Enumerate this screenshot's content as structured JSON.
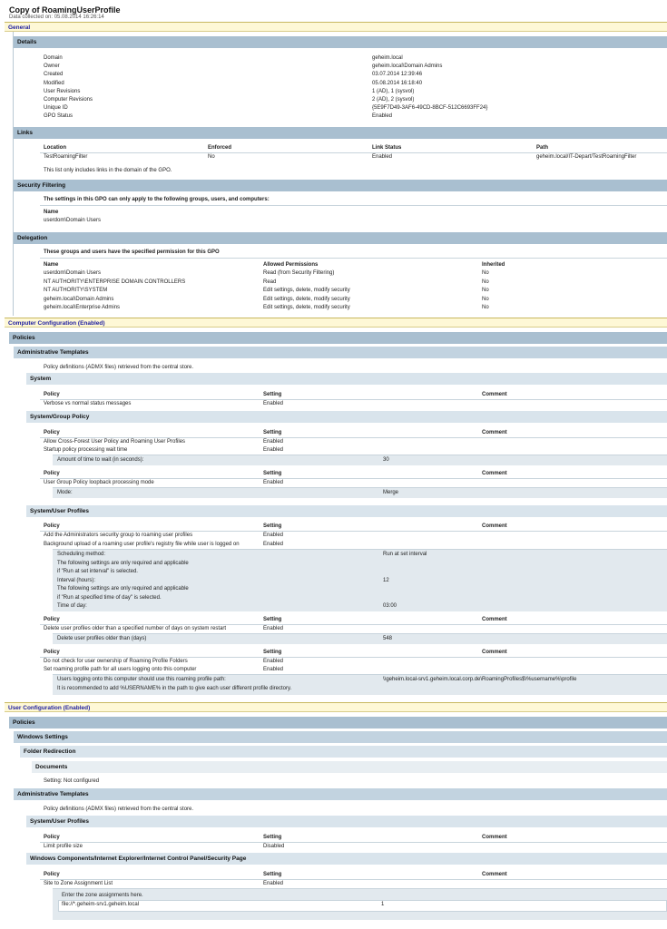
{
  "title": "Copy of RoamingUserProfile",
  "subtitle": "Data collected on: 05.08.2014 16:26:14",
  "general": {
    "label": "General",
    "details": {
      "label": "Details",
      "rows": [
        {
          "k": "Domain",
          "v": "geheim.local"
        },
        {
          "k": "Owner",
          "v": "geheim.local\\Domain Admins"
        },
        {
          "k": "Created",
          "v": "03.07.2014 12:39:46"
        },
        {
          "k": "Modified",
          "v": "05.08.2014 16:18:40"
        },
        {
          "k": "User Revisions",
          "v": "1 (AD), 1 (sysvol)"
        },
        {
          "k": "Computer Revisions",
          "v": "2 (AD), 2 (sysvol)"
        },
        {
          "k": "Unique ID",
          "v": "{5E9F7D49-3AF6-49CD-8BCF-512C6693FF24}"
        },
        {
          "k": "GPO Status",
          "v": "Enabled"
        }
      ]
    },
    "links": {
      "label": "Links",
      "headers": [
        "Location",
        "Enforced",
        "Link Status",
        "Path"
      ],
      "row": [
        "TestRoamingFilter",
        "No",
        "Enabled",
        "geheim.local/IT-Depart/TestRoamingFilter"
      ],
      "note": "This list only includes links in the domain of the GPO."
    },
    "security": {
      "label": "Security Filtering",
      "intro": "The settings in this GPO can only apply to the following groups, users, and computers:",
      "name_header": "Name",
      "name": "userdom\\Domain Users"
    },
    "delegation": {
      "label": "Delegation",
      "intro": "These groups and users have the specified permission for this GPO",
      "headers": [
        "Name",
        "Allowed Permissions",
        "Inherited"
      ],
      "rows": [
        [
          "userdom\\Domain Users",
          "Read (from Security Filtering)",
          "No"
        ],
        [
          "NT AUTHORITY\\ENTERPRISE DOMAIN CONTROLLERS",
          "Read",
          "No"
        ],
        [
          "NT AUTHORITY\\SYSTEM",
          "Edit settings, delete, modify security",
          "No"
        ],
        [
          "geheim.local\\Domain Admins",
          "Edit settings, delete, modify security",
          "No"
        ],
        [
          "geheim.local\\Enterprise Admins",
          "Edit settings, delete, modify security",
          "No"
        ]
      ]
    }
  },
  "computer": {
    "label": "Computer Configuration (Enabled)",
    "policies": "Policies",
    "admin_templates": "Administrative Templates",
    "admx_note": "Policy definitions (ADMX files) retrieved from the central store.",
    "hdr": {
      "policy": "Policy",
      "setting": "Setting",
      "comment": "Comment"
    },
    "system": {
      "label": "System",
      "rows": [
        [
          "Verbose vs normal status messages",
          "Enabled"
        ]
      ]
    },
    "group_policy": {
      "label": "System/Group Policy",
      "rows1": [
        [
          "Allow Cross-Forest User Policy and Roaming User Profiles",
          "Enabled"
        ],
        [
          "Startup policy processing wait time",
          "Enabled"
        ]
      ],
      "sub1": [
        "Amount of time to wait (in seconds):",
        "30"
      ],
      "rows2": [
        [
          "User Group Policy loopback processing mode",
          "Enabled"
        ]
      ],
      "sub2": [
        "Mode:",
        "Merge"
      ]
    },
    "user_profiles": {
      "label": "System/User Profiles",
      "rows1": [
        [
          "Add the Administrators security group to roaming user profiles",
          "Enabled"
        ],
        [
          "Background upload of a roaming user profile's registry file while user is logged on",
          "Enabled"
        ]
      ],
      "sub1": [
        [
          "Scheduling method:",
          "Run at set interval"
        ],
        [
          "The following settings are only required and applicable",
          ""
        ],
        [
          "if \"Run at set interval\" is selected.",
          ""
        ],
        [
          "Interval (hours):",
          "12"
        ],
        [
          "The following settings are only required and applicable",
          ""
        ],
        [
          "if \"Run at specified time of day\" is selected.",
          ""
        ],
        [
          "Time of day:",
          "03:00"
        ]
      ],
      "rows2": [
        [
          "Delete user profiles older than a specified number of days on system restart",
          "Enabled"
        ]
      ],
      "sub2": [
        "Delete user profiles older than (days)",
        "548"
      ],
      "rows3": [
        [
          "Do not check for user ownership of Roaming Profile Folders",
          "Enabled"
        ],
        [
          "Set roaming profile path for all users logging onto this computer",
          "Enabled"
        ]
      ],
      "sub3": [
        [
          "Users logging onto this computer should use this roaming profile path:",
          "\\\\geheim.local-srv1.geheim.local.corp.de\\RoamingProfiles$\\%username%\\profile"
        ],
        [
          "It is recommended to add %USERNAME% in the path to give each user different profile directory.",
          ""
        ]
      ]
    }
  },
  "user": {
    "label": "User Configuration (Enabled)",
    "policies": "Policies",
    "windows_settings": "Windows Settings",
    "folder_redirection": "Folder Redirection",
    "documents": "Documents",
    "doc_setting": "Setting: Not configured",
    "admin_templates": "Administrative Templates",
    "admx_note": "Policy definitions (ADMX files) retrieved from the central store.",
    "user_profiles": {
      "label": "System/User Profiles",
      "rows": [
        [
          "Limit profile size",
          "Disabled"
        ]
      ]
    },
    "ie": {
      "label": "Windows Components/Internet Explorer/Internet Control Panel/Security Page",
      "rows": [
        [
          "Site to Zone Assignment List",
          "Enabled"
        ]
      ],
      "zone_intro": "Enter the zone assignments here.",
      "zone_row": [
        "file://*.geheim-srv1.geheim.local",
        "1"
      ]
    }
  }
}
